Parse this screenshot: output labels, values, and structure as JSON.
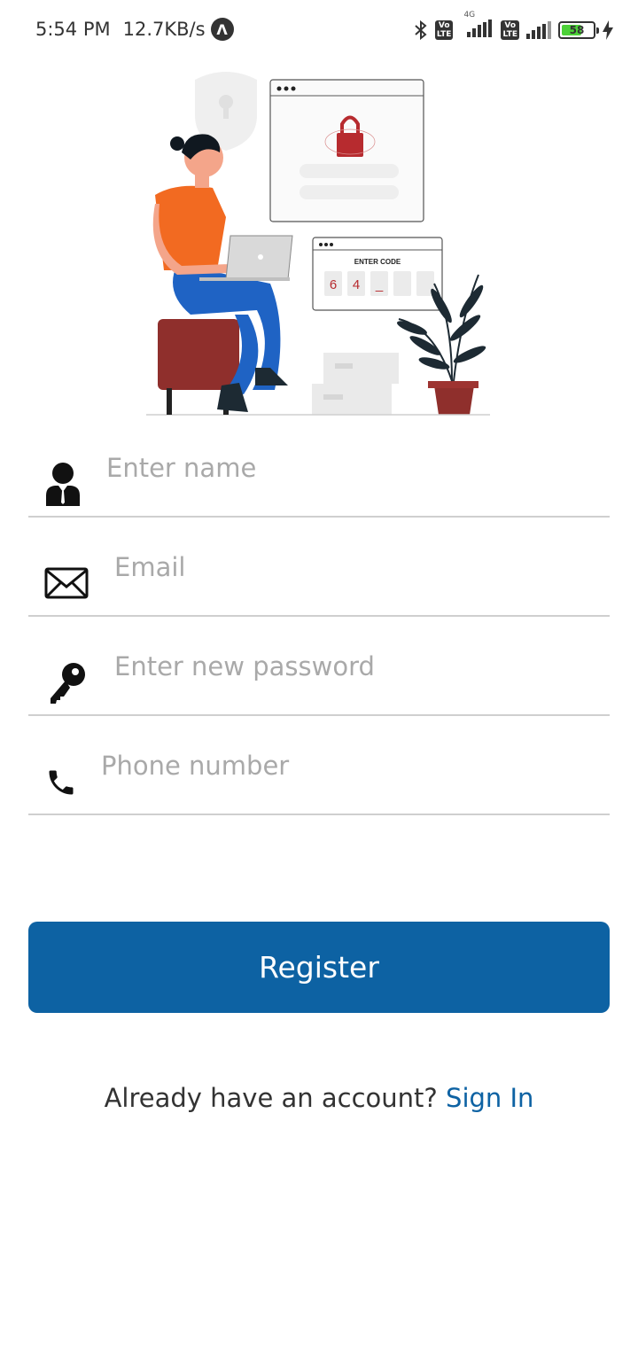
{
  "status_bar": {
    "time": "5:54 PM",
    "speed": "12.7KB/s",
    "nav_badge": "Λ",
    "volte_label": "Vo LTE",
    "network_label": "4G",
    "battery": "58",
    "battery_level": 0.58
  },
  "illustration": {
    "enter_code_label": "ENTER CODE",
    "code_digits": [
      "6",
      "4",
      "_",
      "",
      ""
    ],
    "colors": {
      "shirt": "#f26a21",
      "pants": "#1f63c4",
      "chair": "#8f2f2c",
      "lock": "#b72b2f"
    }
  },
  "form": {
    "name_placeholder": "Enter name",
    "email_placeholder": "Email",
    "password_placeholder": "Enter new password",
    "phone_placeholder": "Phone number",
    "register_label": "Register"
  },
  "footer": {
    "prompt": "Already have an account? ",
    "signin_label": "Sign In"
  },
  "colors": {
    "accent": "#0d62a3",
    "divider": "#cfcfcf",
    "placeholder": "#a9a9a9"
  },
  "icons": [
    "user-icon",
    "mail-icon",
    "key-icon",
    "phone-icon"
  ]
}
